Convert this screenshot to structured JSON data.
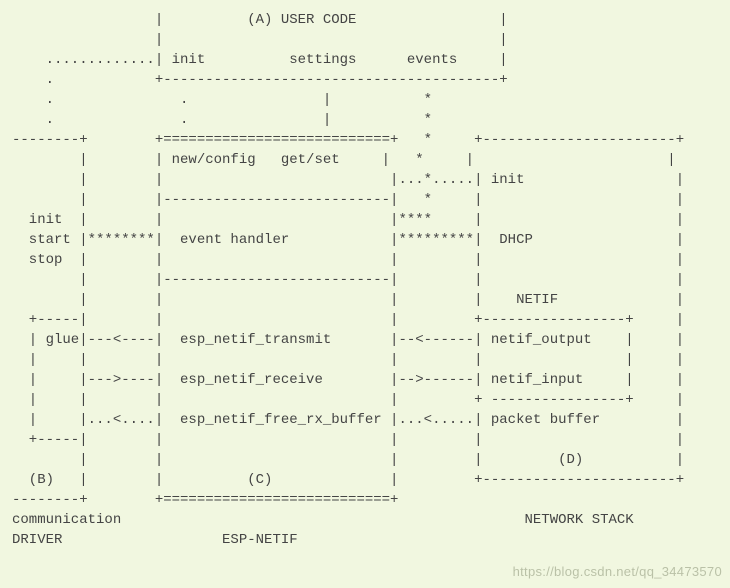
{
  "diagram": {
    "lines": [
      "                 |          (A) USER CODE                 |",
      "                 |                                        |",
      "    .............| init          settings      events     |",
      "    .            +----------------------------------------+",
      "    .               .                |           *",
      "    .               .                |           *",
      "--------+        +===========================+   *     +-----------------------+",
      "        |        | new/config   get/set     |   *     |                       |",
      "        |        |                           |...*.....| init                  |",
      "        |        |---------------------------|   *     |                       |",
      "  init  |        |                           |****     |                       |",
      "  start |********|  event handler            |*********|  DHCP                 |",
      "  stop  |        |                           |         |                       |",
      "        |        |---------------------------|         |                       |",
      "        |        |                           |         |    NETIF              |",
      "  +-----|        |                           |         +-----------------+     |",
      "  | glue|---<----|  esp_netif_transmit       |--<------| netif_output    |     |",
      "  |     |        |                           |         |                 |     |",
      "  |     |--->----|  esp_netif_receive        |-->------| netif_input     |     |",
      "  |     |        |                           |         + ----------------+     |",
      "  |     |...<....|  esp_netif_free_rx_buffer |...<.....| packet buffer         |",
      "  +-----|        |                           |         |                       |",
      "        |        |                           |         |         (D)           |",
      "  (B)   |        |          (C)              |         +-----------------------+",
      "--------+        +===========================+",
      "communication                                                NETWORK STACK",
      "DRIVER                   ESP-NETIF"
    ],
    "sections": {
      "A": "USER CODE",
      "B": "communication DRIVER",
      "C": "ESP-NETIF",
      "D": "NETWORK STACK"
    },
    "user_code_labels": [
      "init",
      "settings",
      "events"
    ],
    "driver_labels": [
      "init",
      "start",
      "stop",
      "glue"
    ],
    "esp_netif_upper": [
      "new/config",
      "get/set"
    ],
    "esp_netif_middle": "event handler",
    "esp_netif_functions": [
      "esp_netif_transmit",
      "esp_netif_receive",
      "esp_netif_free_rx_buffer"
    ],
    "network_stack_top": [
      "init",
      "DHCP",
      "NETIF"
    ],
    "network_stack_funcs": [
      "netif_output",
      "netif_input",
      "packet buffer"
    ]
  },
  "watermark": "https://blog.csdn.net/qq_34473570"
}
